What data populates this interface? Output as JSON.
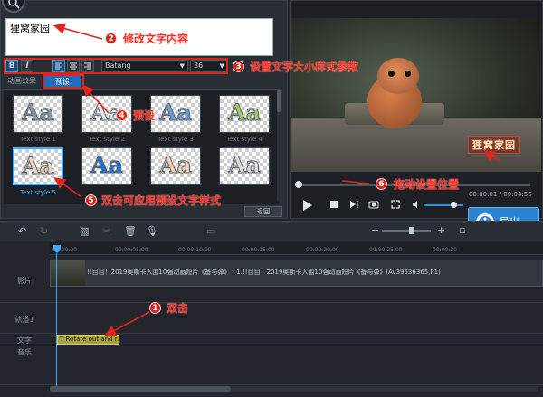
{
  "editor": {
    "text_value": "狸窝家园",
    "bold_label": "B",
    "italic_label": "I",
    "font_name": "Batang",
    "font_size": "36",
    "tabs": [
      {
        "label": "动画效果"
      },
      {
        "label": "预设"
      }
    ],
    "styles": [
      {
        "label": "Text style 1",
        "aa": "Aa",
        "color": "#8c98a6"
      },
      {
        "label": "Text style 2",
        "aa": "Aa",
        "color": "#e9e9e9"
      },
      {
        "label": "Text style 3",
        "aa": "Aa",
        "color": "#6c9bd2"
      },
      {
        "label": "Text style 4",
        "aa": "Aa",
        "color": "#a6c46a"
      },
      {
        "label": "Text style 5",
        "aa": "Aa",
        "color": "#f0d4b4"
      },
      {
        "label": "",
        "aa": "Aa",
        "color": "#1e6cd6"
      },
      {
        "label": "",
        "aa": "Aa",
        "color": "#f6d2a8"
      },
      {
        "label": "",
        "aa": "Aa",
        "color": "#dcdcdc"
      }
    ],
    "back_label": "返回"
  },
  "preview": {
    "watermark": "狸窝家园",
    "time": "00:00:01 / 00:04:56",
    "seek_progress": 0.0
  },
  "export_label": "导出",
  "timeline": {
    "ruler": [
      "00:00:00",
      "00:00:05:00",
      "00:00:10:00",
      "00:00:15:00",
      "00:00:20:00",
      "00:00:25:00",
      "00:00:30"
    ],
    "tracks": [
      {
        "label": "影片"
      },
      {
        "label": "轨道1"
      },
      {
        "label": "文字"
      },
      {
        "label": "音乐"
      }
    ],
    "video_clip_text": "!!目目！2019奥斯卡入围10强动画短片《备与弹》 - 1.!!目目！2019奥斯卡入围10强动画短片《备与弹》(Av39536365,P1)",
    "text_clip": "T Rotate out and r..."
  },
  "annotations": [
    {
      "num": "1",
      "text": "双击"
    },
    {
      "num": "2",
      "text": "修改文字内容"
    },
    {
      "num": "3",
      "text": "设置文字大小样式参数"
    },
    {
      "num": "4",
      "text": "预设"
    },
    {
      "num": "5",
      "text": "双击可应用预设文字样式"
    },
    {
      "num": "6",
      "text": "拖动设置位置"
    }
  ]
}
